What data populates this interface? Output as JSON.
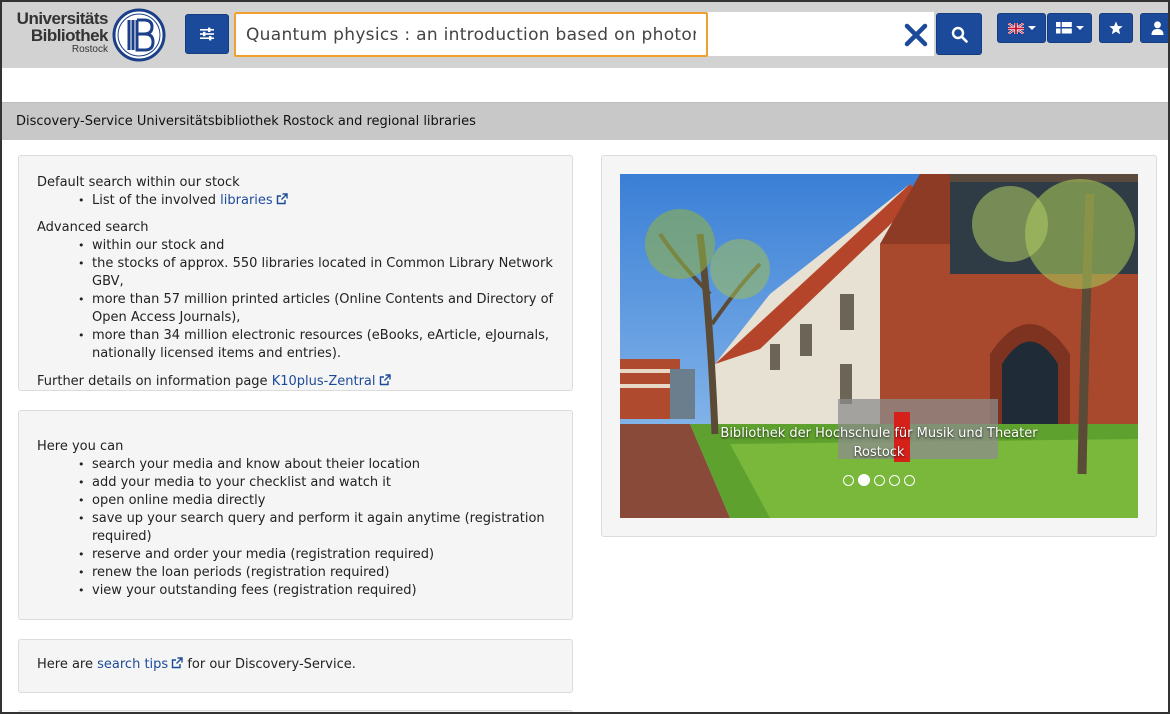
{
  "logo": {
    "line1": "Universitäts",
    "line2": "Bibliothek",
    "line3": "Rostock"
  },
  "search": {
    "value": "Quantum physics : an introduction based on photons",
    "placeholder": ""
  },
  "colors": {
    "primary": "#1c4a9a",
    "focus": "#f0a030",
    "header_bg": "#d2d2d2",
    "panel_bg": "#f5f5f5"
  },
  "icons": {
    "filter": "sliders-icon",
    "clear": "close-icon",
    "search": "search-icon",
    "language": "uk-flag-icon",
    "grid": "grid-icon",
    "favorites": "star-icon",
    "user": "user-icon"
  },
  "titlebar": {
    "text": "Discovery-Service Universitätsbibliothek Rostock and regional libraries"
  },
  "panel1": {
    "default_heading": "Default search within our stock",
    "libraries_prefix": "List of the involved ",
    "libraries_link": "libraries",
    "advanced_heading": "Advanced search",
    "advanced_items": [
      "within our stock and",
      "the stocks of approx. 550 libraries located in Common Library Network GBV,",
      "more than 57 million printed articles (Online Contents and Directory of Open Access Journals),",
      "more than 34 million electronic resources (eBooks, eArticle, eJournals, nationally licensed items and entries)."
    ],
    "further_prefix": "Further details on information page ",
    "further_link": "K10plus-Zentral"
  },
  "panel2": {
    "heading": "Here you can",
    "items": [
      "search your media and know about theier location",
      "add your media to your checklist and watch it",
      "open online media directly",
      "save up your search query and perform it again anytime (registration required)",
      "reserve and order your media (registration required)",
      "renew the loan periods (registration required)",
      "view your outstanding fees (registration required)"
    ]
  },
  "panel3": {
    "prefix": "Here are ",
    "link": "search tips",
    "suffix": " for our Discovery-Service."
  },
  "carousel": {
    "caption_line1": "Bibliothek der Hochschule für Musik und Theater",
    "caption_line2": "Rostock",
    "slide_count": 5,
    "active_slide": 2
  }
}
